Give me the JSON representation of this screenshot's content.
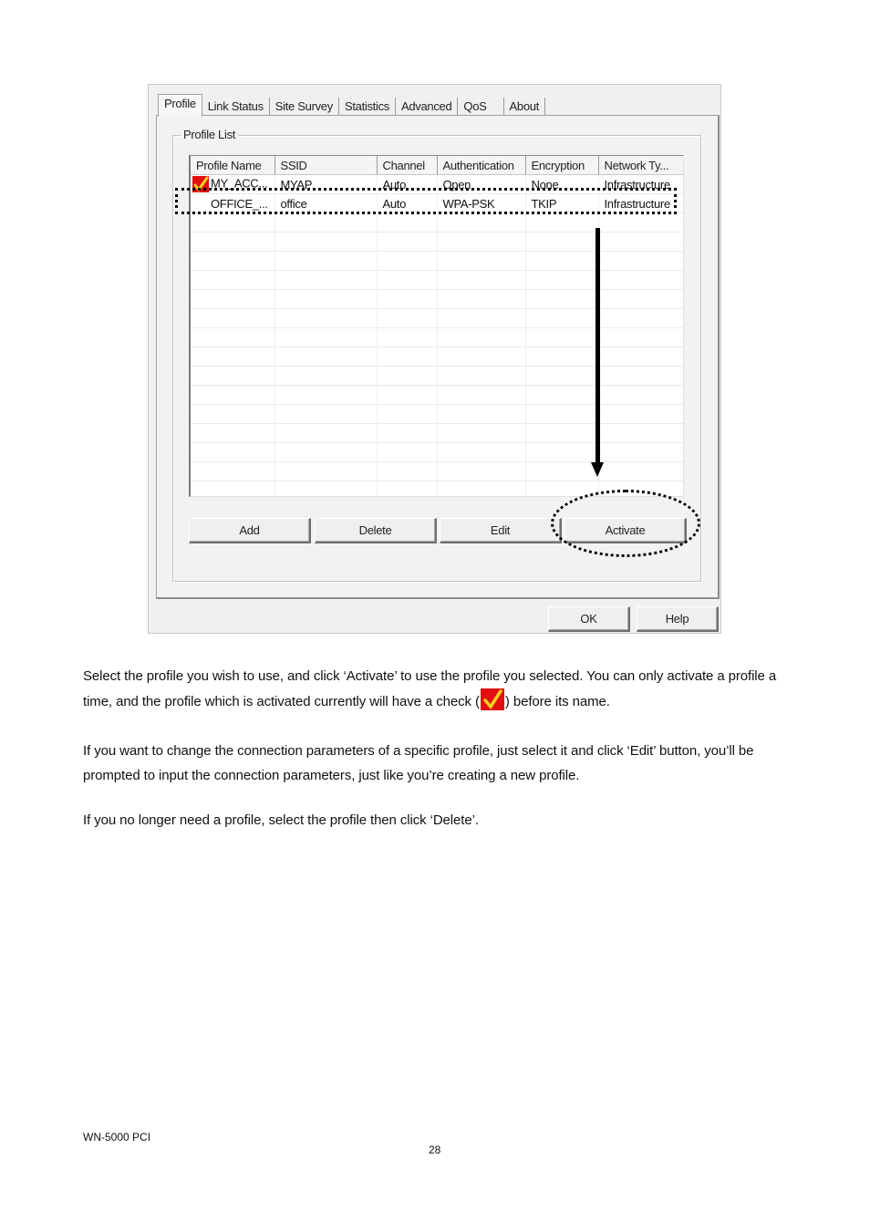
{
  "dialog": {
    "tabs": [
      "Profile",
      "Link Status",
      "Site Survey",
      "Statistics",
      "Advanced",
      "QoS",
      "About"
    ],
    "active_tab": "Profile",
    "group_label": "Profile List",
    "table": {
      "columns": [
        "Profile Name",
        "SSID",
        "Channel",
        "Authentication",
        "Encryption",
        "Network Ty..."
      ],
      "rows": [
        {
          "active": true,
          "cells": [
            "MY_ACC...",
            "MYAP",
            "Auto",
            "Open",
            "None",
            "Infrastructure"
          ]
        },
        {
          "active": false,
          "cells": [
            "OFFICE_...",
            "office",
            "Auto",
            "WPA-PSK",
            "TKIP",
            "Infrastructure"
          ]
        }
      ]
    },
    "buttons": {
      "add": "Add",
      "delete": "Delete",
      "edit": "Edit",
      "activate": "Activate",
      "ok": "OK",
      "help": "Help"
    },
    "check_icon": "red-checkbox-icon"
  },
  "document": {
    "para1_a": "Select the profile you wish to use, and click ‘Activate’ to use the profile you selected. You can only activate a profile a time, and the profile which is activated currently will have a check (",
    "para1_b": ") before its name.",
    "para2": "If you want to change the connection parameters of a specific profile, just select it and click ‘Edit’ button, you’ll be prompted to input the connection parameters, just like you’re creating a new profile.",
    "para3": "If you no longer need a profile, select the profile then click ‘Delete’."
  },
  "footer": {
    "model": "WN-5000 PCI",
    "page_number": "28"
  }
}
